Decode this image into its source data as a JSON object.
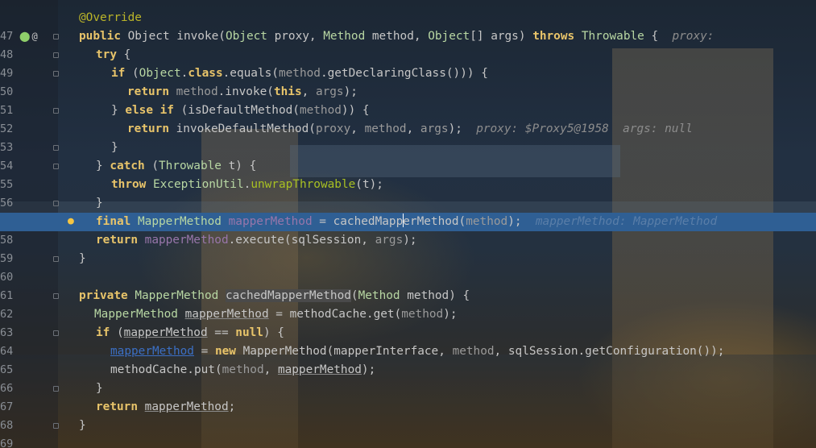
{
  "editor": {
    "line_numbers": [
      "47",
      "48",
      "49",
      "50",
      "51",
      "52",
      "53",
      "54",
      "55",
      "56",
      "57",
      "58",
      "59",
      "60",
      "61",
      "62",
      "63",
      "64",
      "65",
      "66",
      "67",
      "68",
      "69"
    ],
    "icons": {
      "override": "override-icon",
      "annotation": "@",
      "bulb": "lightbulb-icon"
    },
    "lines": {
      "l47": {
        "ann": "@Override"
      },
      "l48": {
        "kw1": "public",
        "t1": " Object invoke(",
        "ty1": "Object",
        "t2": " proxy, ",
        "ty2": "Method",
        "t3": " method, ",
        "ty3": "Object",
        "t4": "[] args) ",
        "kw2": "throws",
        "t5": " ",
        "ty4": "Throwable",
        "t6": " {  ",
        "hint": "proxy:"
      },
      "l49": {
        "kw": "try",
        "t": " {"
      },
      "l50": {
        "kw1": "if",
        "t1": " (",
        "ty1": "Object",
        "t2": ".",
        "kw2": "class",
        "t3": ".equals(",
        "m1": "method",
        "t4": ".getDeclaringClass())) {"
      },
      "l51": {
        "kw1": "return",
        "t1": " ",
        "m1": "method",
        "t2": ".invoke(",
        "kw2": "this",
        "t3": ", ",
        "m2": "args",
        "t4": ");"
      },
      "l52": {
        "t1": "} ",
        "kw1": "else if",
        "t2": " (isDefaultMethod(",
        "m1": "method",
        "t3": ")) {"
      },
      "l53": {
        "kw1": "return",
        "t1": " invokeDefaultMethod(",
        "m1": "proxy",
        "t2": ", ",
        "m2": "method",
        "t3": ", ",
        "m3": "args",
        "t4": ");  ",
        "hint": "proxy: $Proxy5@1958  args: null"
      },
      "l54": {
        "t": "}"
      },
      "l55": {
        "t1": "} ",
        "kw1": "catch",
        "t2": " (",
        "ty1": "Throwable",
        "t3": " t) {"
      },
      "l56": {
        "kw1": "throw",
        "t1": " ",
        "ty1": "ExceptionUtil",
        "t2": ".",
        "f1": "unwrapThrowable",
        "t3": "(t);"
      },
      "l57": {
        "t": "}"
      },
      "l58": {
        "kw1": "final",
        "t1": " ",
        "ty1": "MapperMethod",
        "t2": " ",
        "fl1": "mapperMethod",
        "t3": " = cachedMapp",
        "t4": "erMethod(",
        "m1": "method",
        "t5": ");  ",
        "hint": "mapperMethod: MapperMethod"
      },
      "l59": {
        "kw1": "return",
        "t1": " ",
        "fl1": "mapperMethod",
        "t2": ".execute(sqlSession, ",
        "m1": "args",
        "t3": ");"
      },
      "l60": {
        "t": "}"
      },
      "l61": {
        "t": ""
      },
      "l62": {
        "kw1": "private",
        "t1": " ",
        "ty1": "MapperMethod",
        "t2": " ",
        "sel": "cachedMapperMethod",
        "t3": "(",
        "ty2": "Method",
        "t4": " method) {"
      },
      "l63": {
        "ty1": "MapperMethod",
        "t1": " ",
        "u1": "mapperMethod",
        "t2": " = methodCache.get(",
        "m1": "method",
        "t3": ");"
      },
      "l64": {
        "kw1": "if",
        "t1": " (",
        "u1": "mapperMethod",
        "t2": " == ",
        "kw2": "null",
        "t3": ") {"
      },
      "l65": {
        "lk": "mapperMethod",
        "t1": " = ",
        "kw1": "new",
        "t2": " MapperMethod(mapperInterface, ",
        "m1": "method",
        "t3": ", sqlSession.getConfiguration());"
      },
      "l66": {
        "t1": "methodCache.put(",
        "m1": "method",
        "t2": ", ",
        "u1": "mapperMethod",
        "t3": ");"
      },
      "l67": {
        "t": "}"
      },
      "l68": {
        "kw1": "return",
        "t1": " ",
        "u1": "mapperMethod",
        "t2": ";"
      },
      "l69": {
        "t": "}"
      }
    },
    "colors": {
      "keyword": "#e8c46a",
      "type": "#b8d7a3",
      "annotation": "#bbb529",
      "field": "#9876aa",
      "current_line": "#2f5f94"
    }
  }
}
